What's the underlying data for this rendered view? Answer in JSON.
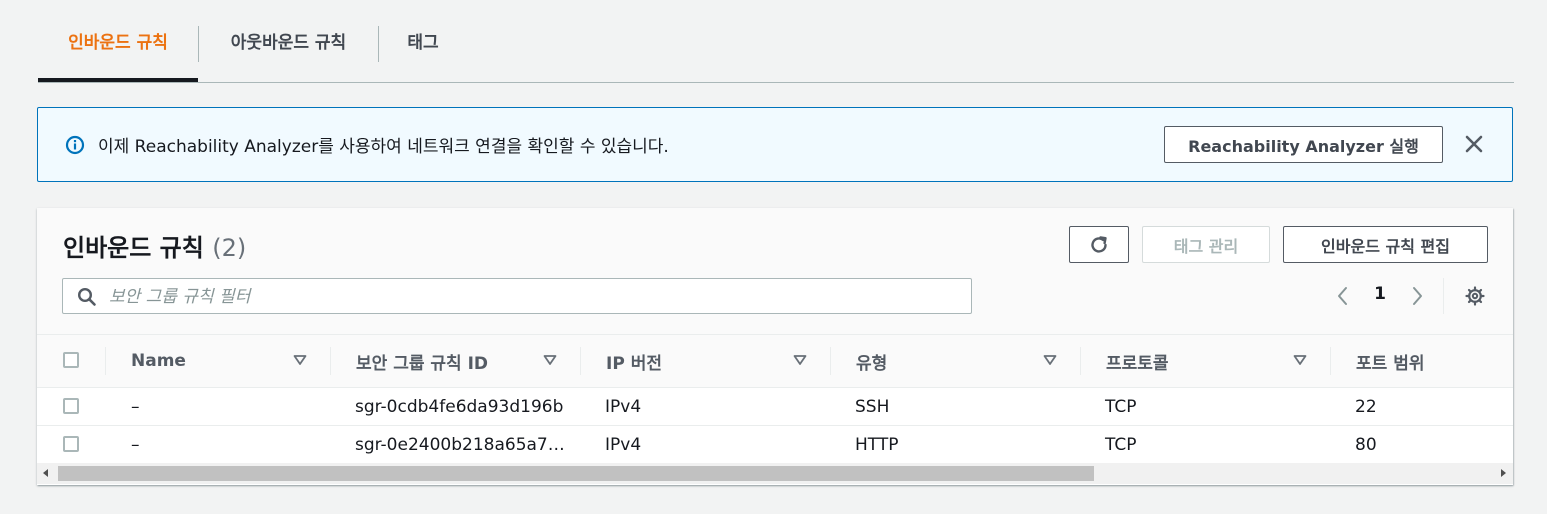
{
  "tabs": [
    {
      "label": "인바운드 규칙",
      "active": true
    },
    {
      "label": "아웃바운드 규칙",
      "active": false
    },
    {
      "label": "태그",
      "active": false
    }
  ],
  "banner": {
    "icon": "info-icon",
    "text": "이제 Reachability Analyzer를 사용하여 네트워크 연결을 확인할 수 있습니다.",
    "button_label": "Reachability Analyzer 실행",
    "close_icon": "close-icon"
  },
  "panel": {
    "title": "인바운드 규칙",
    "count": "(2)",
    "buttons": {
      "refresh_icon": "refresh-icon",
      "manage_tags": "태그 관리",
      "edit_rules": "인바운드 규칙 편집"
    },
    "search": {
      "placeholder": "보안 그룹 규칙 필터",
      "value": ""
    },
    "pagination": {
      "current_page": "1"
    }
  },
  "table": {
    "columns": [
      "Name",
      "보안 그룹 규칙 ID",
      "IP 버전",
      "유형",
      "프로토콜",
      "포트 범위"
    ],
    "rows": [
      {
        "name": "–",
        "rule_id": "sgr-0cdb4fe6da93d196b",
        "ip_version": "IPv4",
        "type": "SSH",
        "protocol": "TCP",
        "port_range": "22"
      },
      {
        "name": "–",
        "rule_id": "sgr-0e2400b218a65a7…",
        "ip_version": "IPv4",
        "type": "HTTP",
        "protocol": "TCP",
        "port_range": "80"
      }
    ]
  },
  "colors": {
    "accent_orange": "#ec7211",
    "info_blue": "#0073bb",
    "banner_bg": "#f1faff",
    "text_dark": "#16191f",
    "text_muted": "#545b64"
  }
}
